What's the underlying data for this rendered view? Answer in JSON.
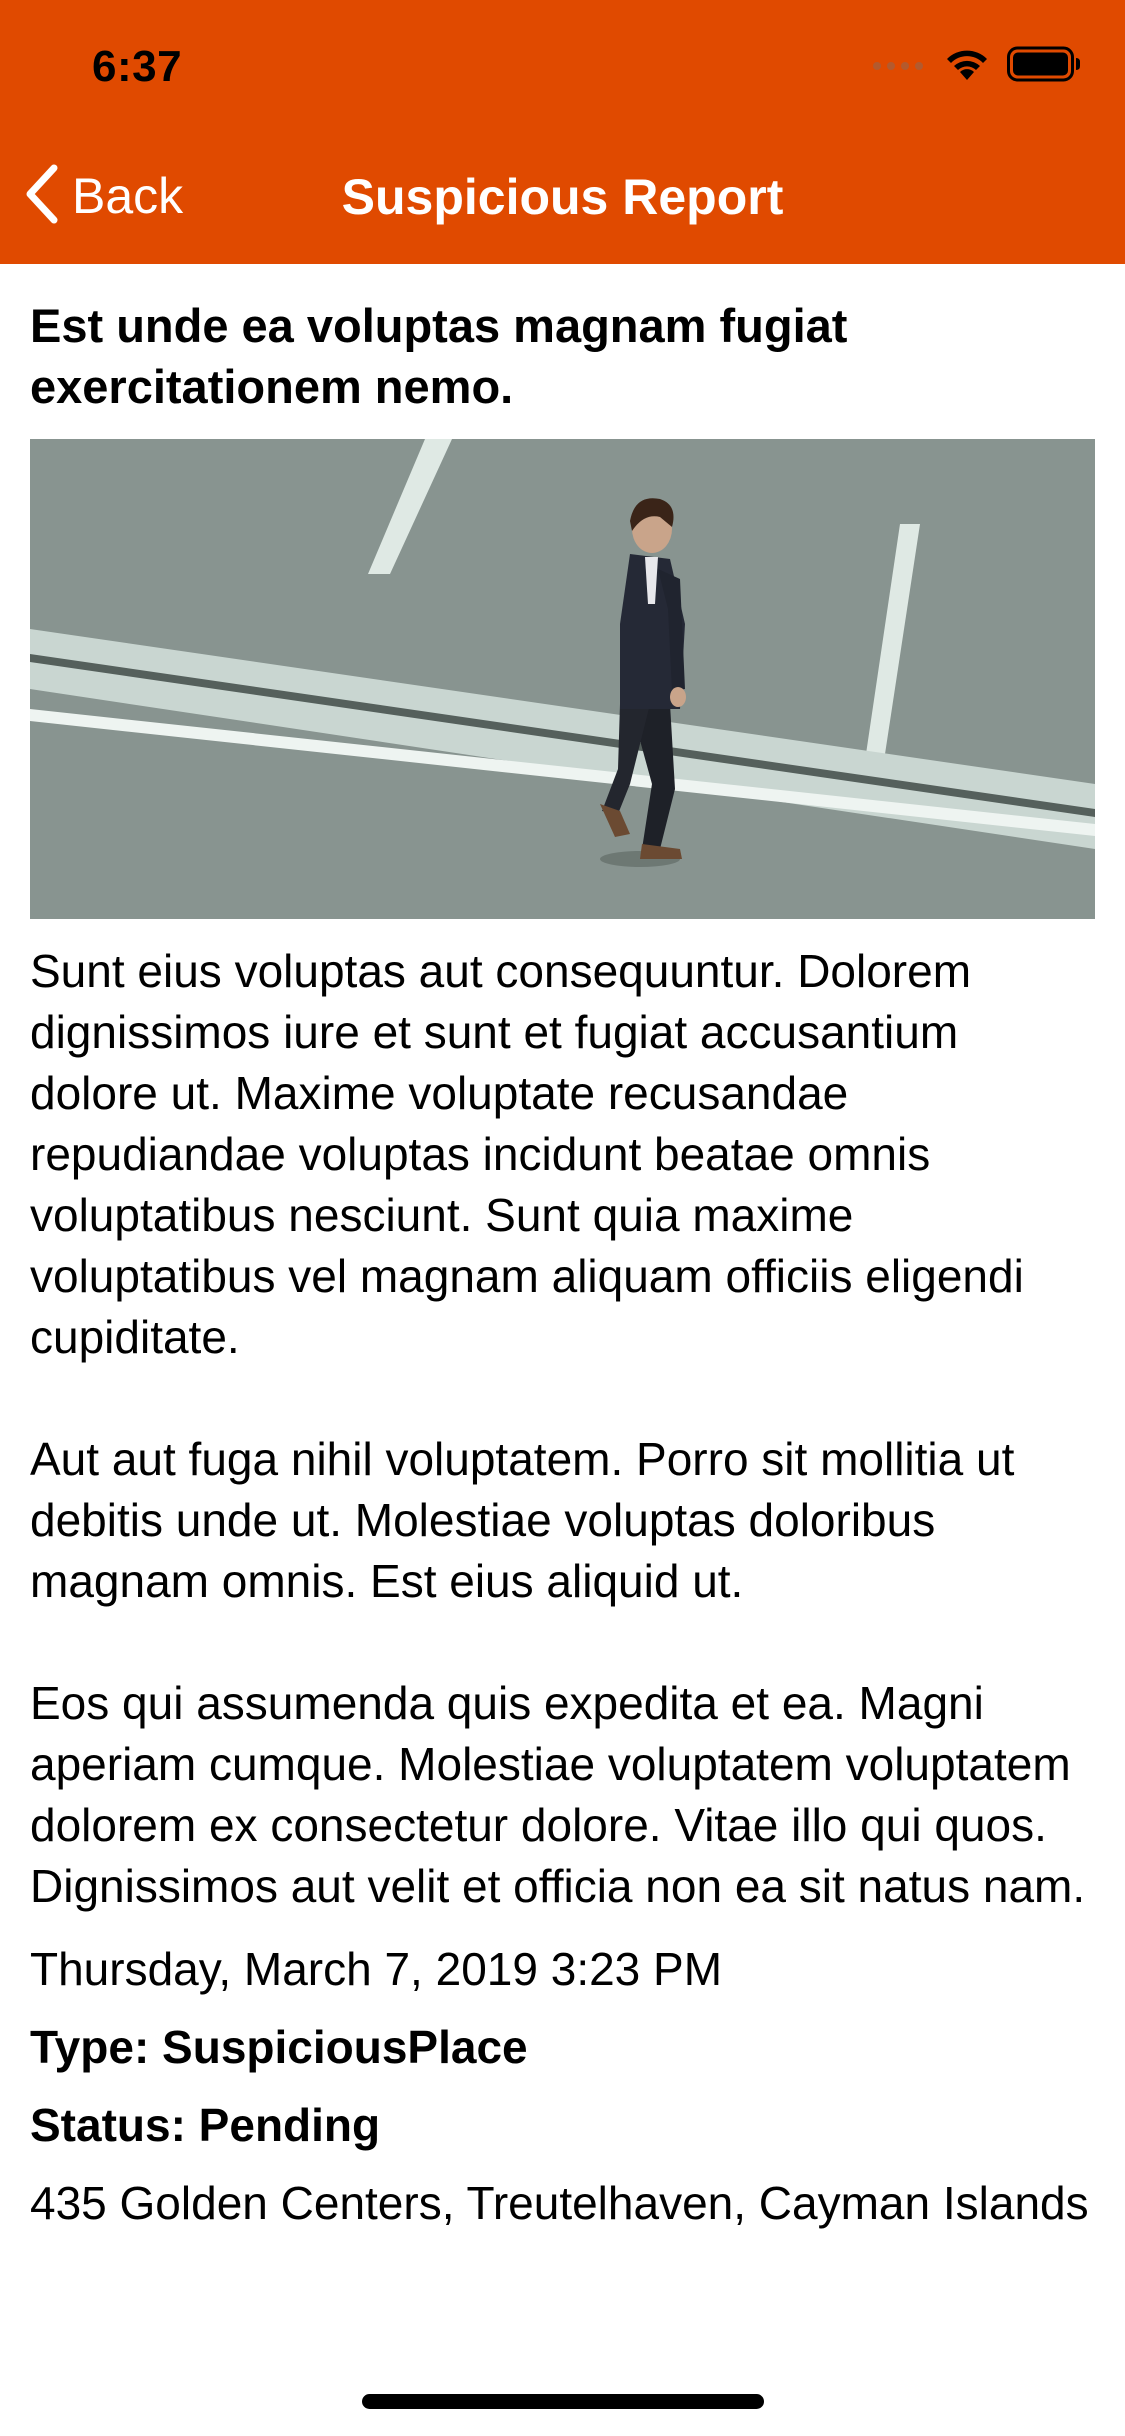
{
  "status_bar": {
    "time": "6:37"
  },
  "nav": {
    "back_label": "Back",
    "title": "Suspicious Report"
  },
  "colors": {
    "header_background": "#e04a00",
    "text": "#000000",
    "nav_text": "#ffffff"
  },
  "icons": {
    "back": "chevron-left-icon",
    "signal": "cellular-signal-icon",
    "wifi": "wifi-icon",
    "battery": "battery-icon"
  },
  "report": {
    "title": "Est unde ea voluptas magnam fugiat exercitationem nemo.",
    "description": "Sunt eius voluptas aut consequuntur. Dolorem dignissimos iure et sunt et fugiat accusantium dolore ut. Maxime voluptate recusandae repudiandae voluptas incidunt beatae omnis voluptatibus nesciunt. Sunt quia maxime voluptatibus vel magnam aliquam officiis eligendi cupiditate.\n\nAut aut fuga nihil voluptatem. Porro sit mollitia ut debitis unde ut. Molestiae voluptas doloribus magnam omnis. Est eius aliquid ut.\n\nEos qui assumenda quis expedita et ea. Magni aperiam cumque. Molestiae voluptatem voluptatem dolorem ex consectetur dolore. Vitae illo qui quos. Dignissimos aut velit et officia non ea sit natus nam.",
    "date": "Thursday, March 7, 2019 3:23 PM",
    "type": "Type: SuspiciousPlace",
    "status": "Status: Pending",
    "address": "435 Golden Centers, Treutelhaven, Cayman Islands"
  }
}
